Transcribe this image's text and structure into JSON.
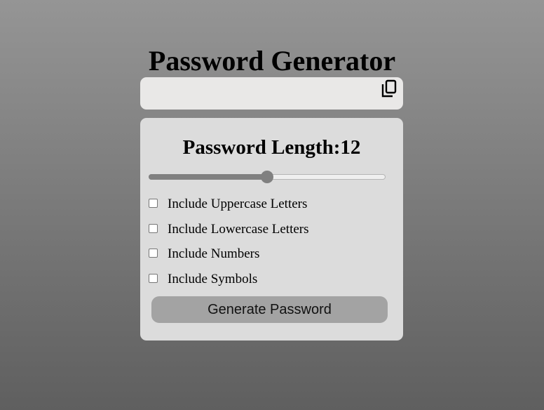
{
  "app": {
    "title": "Password Generator"
  },
  "output": {
    "password": "",
    "copy_icon": "copy-icon"
  },
  "settings": {
    "length_label": "Password Length:",
    "length_value": "12",
    "slider": {
      "min": 4,
      "max": 20,
      "value": 12
    },
    "options": [
      {
        "label": "Include Uppercase Letters",
        "checked": false
      },
      {
        "label": "Include Lowercase Letters",
        "checked": false
      },
      {
        "label": "Include Numbers",
        "checked": false
      },
      {
        "label": "Include Symbols",
        "checked": false
      }
    ],
    "generate_label": "Generate Password"
  },
  "colors": {
    "background_top": "#959595",
    "background_bottom": "#5f5f5f",
    "panel": "#dcdcdc",
    "output_box": "#e9e8e7",
    "button": "#a3a3a3",
    "slider_accent": "#808080"
  }
}
